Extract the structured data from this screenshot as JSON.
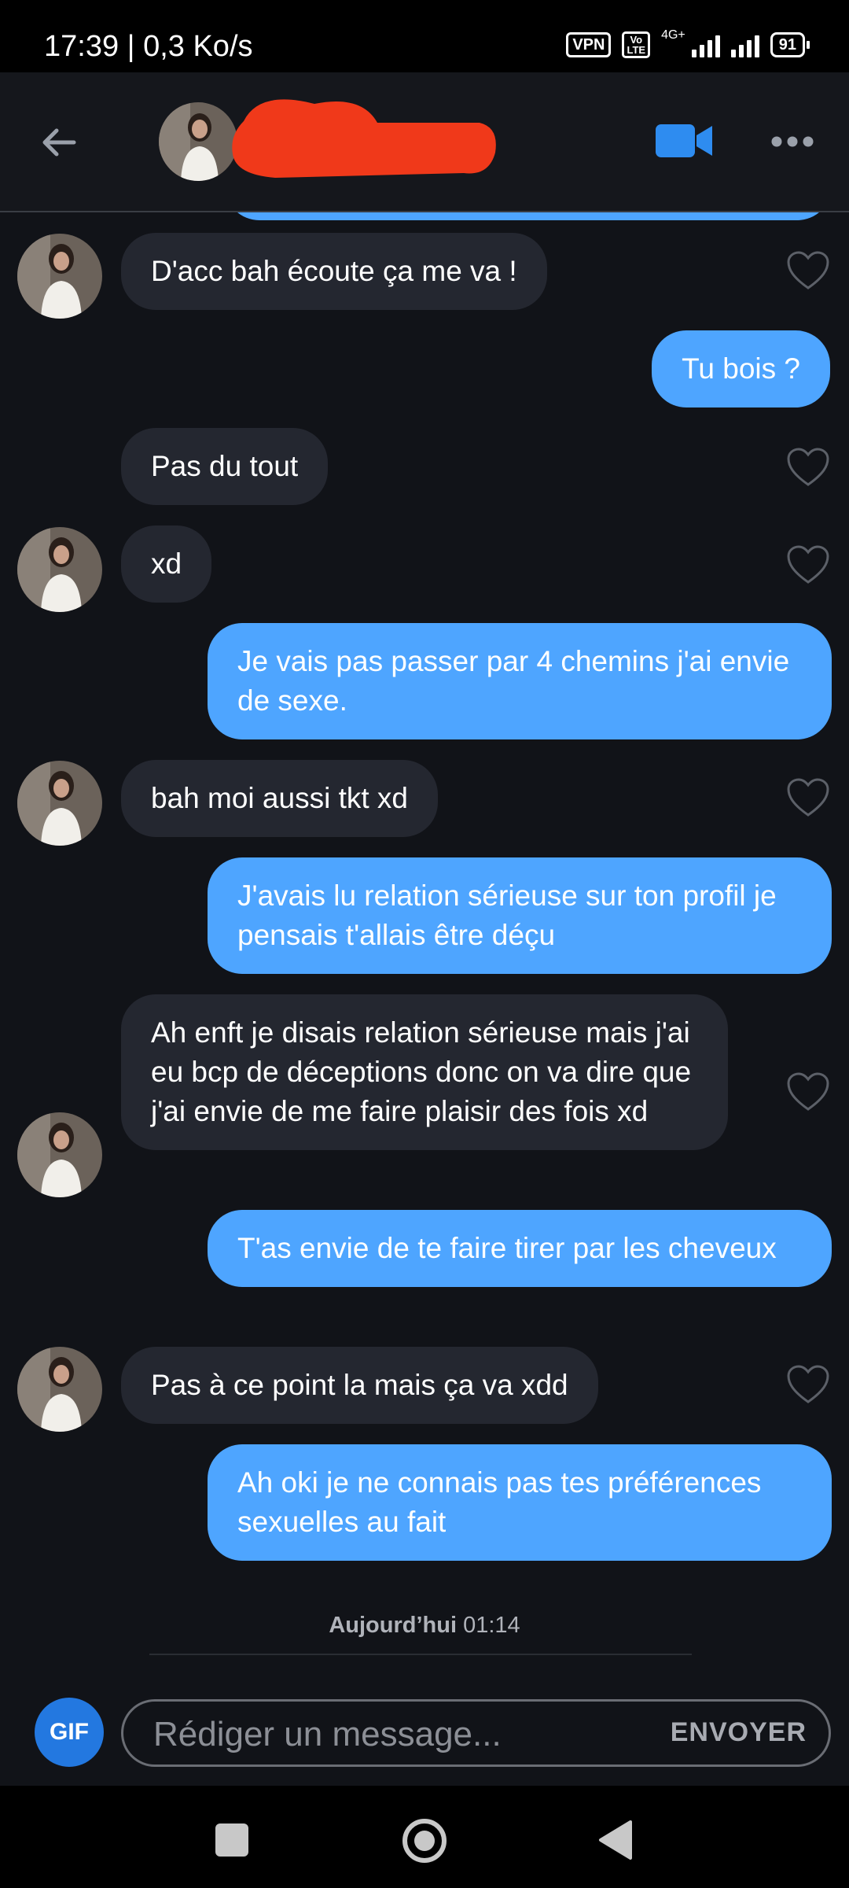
{
  "status_bar": {
    "time": "17:39 | 0,3 Ko/s",
    "vpn": "VPN",
    "volte_top": "Vo",
    "volte_bottom": "LTE",
    "network": "4G+",
    "battery": "91"
  },
  "header": {
    "back_icon": "arrow-left-icon",
    "video_icon": "video-camera-icon",
    "more_icon": "more-dots-icon"
  },
  "messages": [
    {
      "from": "them",
      "text": "D'acc bah écoute ça me va !",
      "avatar": true
    },
    {
      "from": "me",
      "text": "Tu bois ?"
    },
    {
      "from": "them",
      "text": "Pas du tout",
      "avatar": false
    },
    {
      "from": "them",
      "text": "xd",
      "avatar": true
    },
    {
      "from": "me",
      "text": "Je vais pas passer par 4 chemins j'ai envie de sexe."
    },
    {
      "from": "them",
      "text": "bah moi aussi tkt xd",
      "avatar": true
    },
    {
      "from": "me",
      "text": "J'avais lu relation sérieuse sur ton profil je pensais t'allais être déçu"
    },
    {
      "from": "them",
      "text": "Ah enft je disais relation sérieuse mais j'ai eu bcp de déceptions donc on va dire que j'ai envie de me faire plaisir des fois xd",
      "avatar": true
    },
    {
      "from": "me",
      "text": "T'as envie de te faire tirer par les cheveux"
    },
    {
      "from": "them",
      "text": "Pas à ce point la mais ça va xdd",
      "avatar": true
    },
    {
      "from": "me",
      "text": "Ah oki je ne connais pas tes préférences sexuelles au fait"
    }
  ],
  "timestamp": {
    "day": "Aujourd’hui",
    "time": "01:14"
  },
  "composer": {
    "gif_label": "GIF",
    "placeholder": "Rédiger un message...",
    "send_label": "ENVOYER"
  },
  "colors": {
    "background": "#111318",
    "incoming_bubble": "#242730",
    "outgoing_bubble": "#4ea5ff",
    "accent": "#2378e0"
  }
}
